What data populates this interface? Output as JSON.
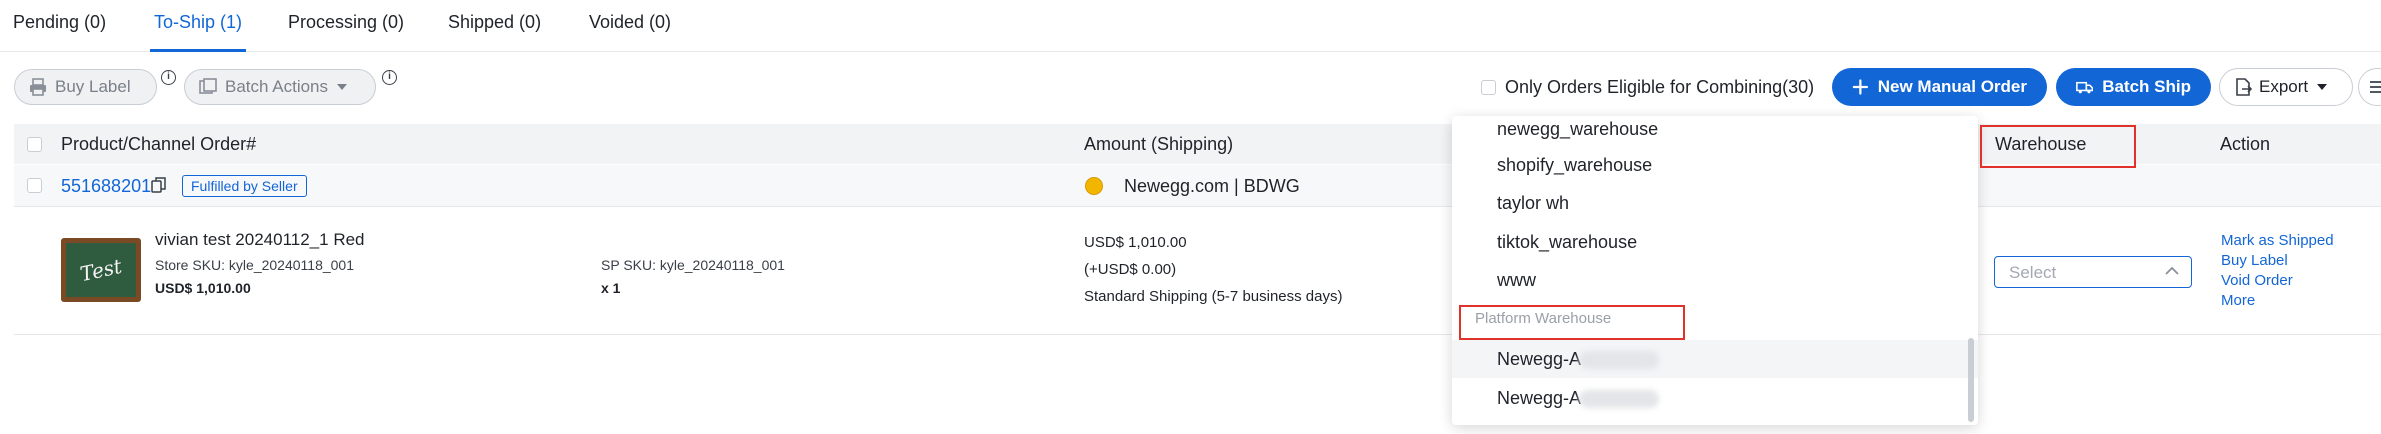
{
  "tabs": [
    {
      "label": "Pending (0)"
    },
    {
      "label": "To-Ship (1)"
    },
    {
      "label": "Processing (0)"
    },
    {
      "label": "Shipped (0)"
    },
    {
      "label": "Voided (0)"
    }
  ],
  "toolbar": {
    "buy_label": "Buy Label",
    "batch_actions": "Batch Actions",
    "info_glyph": "i",
    "combine_label": "Only Orders Eligible for Combining(30)",
    "new_manual_order": "New Manual Order",
    "batch_ship": "Batch Ship",
    "export": "Export"
  },
  "table": {
    "headers": {
      "product": "Product/Channel Order#",
      "amount": "Amount (Shipping)",
      "warehouse": "Warehouse",
      "action": "Action"
    },
    "order": {
      "number": "551688201",
      "badge": "Fulfilled by Seller",
      "channel": "Newegg.com | BDWG"
    },
    "item": {
      "thumb_text": "Test",
      "name": "vivian test 20240112_1 Red",
      "store_sku": "Store SKU: kyle_20240118_001",
      "price": "USD$ 1,010.00",
      "sp_sku": "SP SKU: kyle_20240118_001",
      "qty": "x 1",
      "amount": "USD$ 1,010.00",
      "shipping_amount": "(+USD$ 0.00)",
      "shipping_method": "Standard Shipping (5-7 business days)"
    },
    "warehouse_select": {
      "placeholder": "Select"
    },
    "actions": [
      "Mark as Shipped",
      "Buy Label",
      "Void Order",
      "More"
    ]
  },
  "dropdown": {
    "items": [
      "newegg_warehouse",
      "shopify_warehouse",
      "taylor wh",
      "tiktok_warehouse",
      "www"
    ],
    "group_label": "Platform Warehouse",
    "platform_items": [
      "Newegg-A",
      "Newegg-A"
    ]
  },
  "colors": {
    "accent": "#1266d6",
    "highlight_box": "#e0322b"
  }
}
